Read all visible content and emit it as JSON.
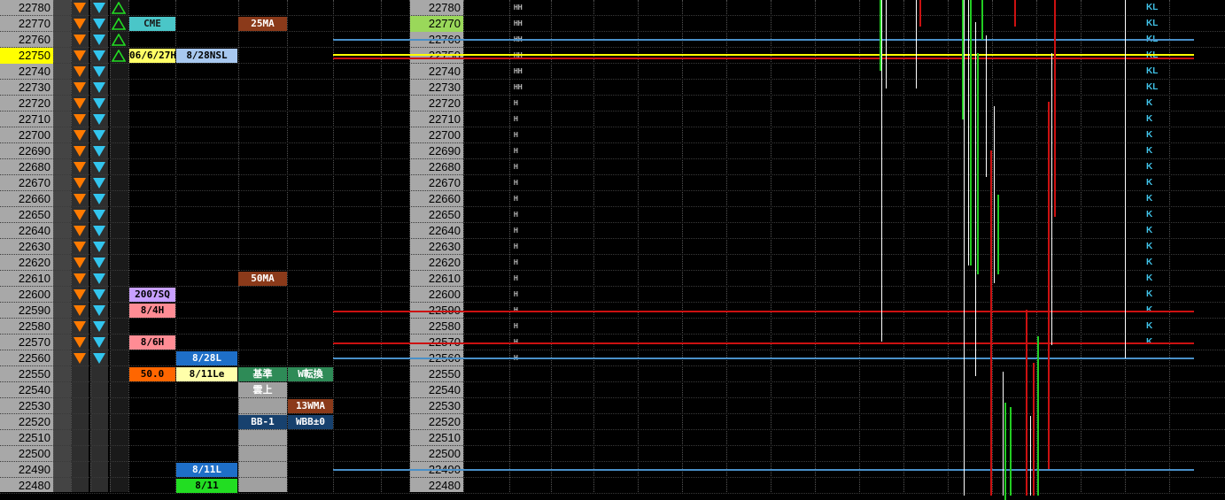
{
  "colors": {
    "price_bg": "#a8a8a8",
    "price_highlight": "#ffff00",
    "price_right_highlight": "#9ad85a",
    "sell_arrow": "#ff7a00",
    "buy_arrow": "#33c5ee",
    "up_triangle": "#22dd22",
    "red_line": "#cc1111",
    "yellow_line": "#ffff00",
    "blue_line": "#4a90c8",
    "kl_color": "#41c4ea"
  },
  "ladder": {
    "prices": [
      "22780",
      "22770",
      "22760",
      "22750",
      "22740",
      "22730",
      "22720",
      "22710",
      "22700",
      "22690",
      "22680",
      "22670",
      "22660",
      "22650",
      "22640",
      "22630",
      "22620",
      "22610",
      "22600",
      "22590",
      "22580",
      "22570",
      "22560",
      "22550",
      "22540",
      "22530",
      "22520",
      "22510",
      "22500",
      "22490",
      "22480"
    ],
    "current_price": "22750",
    "right_highlight_price": "22770"
  },
  "indicators": {
    "sell_arrow_icon": "triangle-down-orange",
    "buy_arrow_icon": "triangle-down-cyan",
    "up_icon": "triangle-up-outline-green",
    "up_rows": [
      0,
      1,
      2,
      3
    ]
  },
  "tags": [
    {
      "row": 1,
      "col": "c1",
      "text": "CME",
      "bg": "#4ac6c8",
      "fg": "#1a1a1a"
    },
    {
      "row": 3,
      "col": "c1",
      "text": "06/6/27H",
      "bg": "#ffff66",
      "fg": "#000000"
    },
    {
      "row": 3,
      "col": "c2",
      "text": "8/28NSL",
      "bg": "#a8c8f0",
      "fg": "#000000"
    },
    {
      "row": 18,
      "col": "c1",
      "text": "2007SQ",
      "bg": "#c8a0ff",
      "fg": "#000000"
    },
    {
      "row": 19,
      "col": "c1",
      "text": "8/4H",
      "bg": "#ff8c94",
      "fg": "#000000"
    },
    {
      "row": 21,
      "col": "c1",
      "text": "8/6H",
      "bg": "#ff8c94",
      "fg": "#000000"
    },
    {
      "row": 22,
      "col": "c2",
      "text": "8/28L",
      "bg": "#1e6fc8",
      "fg": "#ffffff"
    },
    {
      "row": 23,
      "col": "c1",
      "text": "50.0",
      "bg": "#ff6600",
      "fg": "#000000"
    },
    {
      "row": 23,
      "col": "c2",
      "text": "8/11Le",
      "bg": "#ffffaa",
      "fg": "#000000"
    },
    {
      "row": 29,
      "col": "c2",
      "text": "8/11L",
      "bg": "#1e6fc8",
      "fg": "#ffffff"
    },
    {
      "row": 30,
      "col": "c2",
      "text": "8/11",
      "bg": "#22dd22",
      "fg": "#000000"
    },
    {
      "row": 1,
      "col": "c3",
      "text": "25MA",
      "bg": "#8b3a1a",
      "fg": "#ffffff"
    },
    {
      "row": 17,
      "col": "c3",
      "text": "50MA",
      "bg": "#8b3a1a",
      "fg": "#ffffff"
    },
    {
      "row": 23,
      "col": "c3",
      "text": "基準",
      "bg": "#2e8b57",
      "fg": "#ffffff"
    },
    {
      "row": 24,
      "col": "c3",
      "text": "雲上",
      "bg": "#a0a0a0",
      "fg": "#ffffff"
    },
    {
      "row": 26,
      "col": "c3",
      "text": "BB-1",
      "bg": "#17416e",
      "fg": "#ffffff"
    },
    {
      "row": 23,
      "col": "c4",
      "text": "W転換",
      "bg": "#2e8b57",
      "fg": "#ffffff"
    },
    {
      "row": 25,
      "col": "c4",
      "text": "13WMA",
      "bg": "#8b3a1a",
      "fg": "#ffffff"
    },
    {
      "row": 26,
      "col": "c4",
      "text": "WBB±0",
      "bg": "#17416e",
      "fg": "#ffffff"
    }
  ],
  "volume_marks": {
    "hh_rows": [
      "HH",
      "HH",
      "HH",
      "HH",
      "HH",
      "HH"
    ],
    "h_mark": "H",
    "kl_marks": [
      "KL",
      "KL",
      "KL",
      "KL",
      "KL",
      "KL"
    ],
    "k_mark": "K"
  },
  "levels": [
    {
      "price": "22750",
      "color": "#ffff00"
    },
    {
      "price": "22750",
      "color": "#cc1111"
    },
    {
      "price": "22590",
      "color": "#cc1111"
    },
    {
      "price": "22570",
      "color": "#cc1111"
    },
    {
      "price": "22760",
      "color": "#4a90c8"
    },
    {
      "price": "22560",
      "color": "#4a90c8"
    },
    {
      "price": "22490",
      "color": "#4a90c8"
    }
  ]
}
